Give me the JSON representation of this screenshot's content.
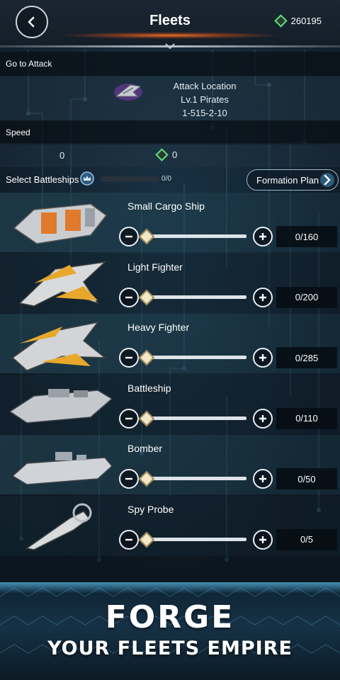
{
  "header": {
    "title": "Fleets",
    "currency_icon": "green-gem-icon",
    "currency_value": "260195"
  },
  "attack": {
    "section_label": "Go to Attack",
    "location_label": "Attack Location",
    "target_name": "Lv.1 Pirates",
    "coordinates": "1-515-2-10"
  },
  "speed": {
    "section_label": "Speed",
    "speed_value": "0",
    "gem_cost": "0"
  },
  "selection": {
    "label": "Select Battleships",
    "capacity": "0/0",
    "formation_button": "Formation Plan"
  },
  "ships": [
    {
      "name": "Small Cargo Ship",
      "count": "0/160",
      "selected_fraction": 0
    },
    {
      "name": "Light Fighter",
      "count": "0/200",
      "selected_fraction": 0
    },
    {
      "name": "Heavy Fighter",
      "count": "0/285",
      "selected_fraction": 0
    },
    {
      "name": "Battleship",
      "count": "0/110",
      "selected_fraction": 0
    },
    {
      "name": "Bomber",
      "count": "0/50",
      "selected_fraction": 0
    },
    {
      "name": "Spy Probe",
      "count": "0/5",
      "selected_fraction": 0
    }
  ],
  "banner": {
    "line1": "FORGE",
    "line2": "YOUR FLEETS EMPIRE"
  },
  "colors": {
    "accent_orange": "#ff7a28",
    "gem_green": "#5fe07a",
    "slider_thumb": "#f2e7c8"
  }
}
